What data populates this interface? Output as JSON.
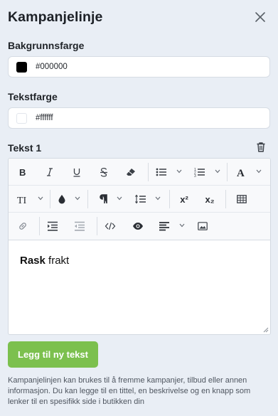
{
  "panel": {
    "title": "Kampanjelinje"
  },
  "background_color": {
    "label": "Bakgrunnsfarge",
    "value": "#000000",
    "swatch": "#000000"
  },
  "text_color": {
    "label": "Tekstfarge",
    "value": "#ffffff",
    "swatch": "#ffffff"
  },
  "text_block": {
    "label": "Tekst 1"
  },
  "editor": {
    "content_bold": "Rask",
    "content_rest": " frakt",
    "toolbar": {
      "superscript_label": "x²",
      "subscript_label": "x₂",
      "font_size_label": "TI",
      "font_color_label": "A"
    }
  },
  "add_button": {
    "label": "Legg til ny tekst",
    "color": "#7cc04e"
  },
  "helper_text": "Kampanjelinjen kan brukes til å fremme kampanjer, tilbud eller annen informasjon. Du kan legge til en tittel, en beskrivelse og en knapp som lenker til en spesifikk side i butikken din"
}
